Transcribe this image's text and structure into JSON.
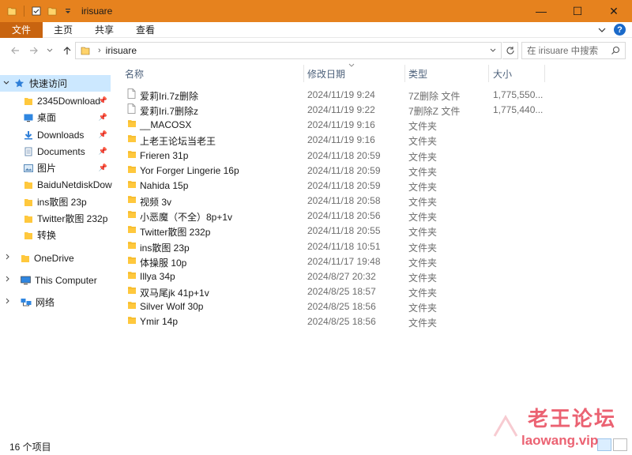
{
  "window": {
    "title": "irisuare",
    "controls": {
      "minimize": "—",
      "maximize": "☐",
      "close": "✕"
    }
  },
  "ribbon": {
    "tabs": [
      "文件",
      "主页",
      "共享",
      "查看"
    ],
    "help": "?"
  },
  "address": {
    "crumb": "irisuare",
    "search_placeholder": "在 irisuare 中搜索"
  },
  "sidebar": {
    "quick_access": "快速访问",
    "items": [
      {
        "label": "2345Download",
        "icon": "folder-icon",
        "pinned": true
      },
      {
        "label": "桌面",
        "icon": "desktop-icon",
        "pinned": true
      },
      {
        "label": "Downloads",
        "icon": "download-icon",
        "pinned": true
      },
      {
        "label": "Documents",
        "icon": "documents-icon",
        "pinned": true
      },
      {
        "label": "图片",
        "icon": "pictures-icon",
        "pinned": true
      },
      {
        "label": "BaiduNetdiskDow",
        "icon": "folder-icon",
        "pinned": false
      },
      {
        "label": "ins散图 23p",
        "icon": "folder-icon",
        "pinned": false
      },
      {
        "label": "Twitter散图 232p",
        "icon": "folder-icon",
        "pinned": false
      },
      {
        "label": "转换",
        "icon": "folder-icon",
        "pinned": false
      }
    ],
    "onedrive": "OneDrive",
    "this_computer": "This Computer",
    "network": "网络"
  },
  "columns": {
    "name": "名称",
    "date": "修改日期",
    "type": "类型",
    "size": "大小"
  },
  "files": [
    {
      "name": "爱莉Iri.7z删除",
      "date": "2024/11/19 9:24",
      "type": "7Z删除 文件",
      "size": "1,775,550...",
      "kind": "file"
    },
    {
      "name": "爱莉Iri.7删除z",
      "date": "2024/11/19 9:22",
      "type": "7删除Z 文件",
      "size": "1,775,440...",
      "kind": "file"
    },
    {
      "name": "__MACOSX",
      "date": "2024/11/19 9:16",
      "type": "文件夹",
      "size": "",
      "kind": "folder"
    },
    {
      "name": "上老王论坛当老王",
      "date": "2024/11/19 9:16",
      "type": "文件夹",
      "size": "",
      "kind": "folder"
    },
    {
      "name": "Frieren 31p",
      "date": "2024/11/18 20:59",
      "type": "文件夹",
      "size": "",
      "kind": "folder"
    },
    {
      "name": "Yor Forger Lingerie 16p",
      "date": "2024/11/18 20:59",
      "type": "文件夹",
      "size": "",
      "kind": "folder"
    },
    {
      "name": "Nahida 15p",
      "date": "2024/11/18 20:59",
      "type": "文件夹",
      "size": "",
      "kind": "folder"
    },
    {
      "name": "视频 3v",
      "date": "2024/11/18 20:58",
      "type": "文件夹",
      "size": "",
      "kind": "folder"
    },
    {
      "name": "小恶魔（不全）8p+1v",
      "date": "2024/11/18 20:56",
      "type": "文件夹",
      "size": "",
      "kind": "folder"
    },
    {
      "name": "Twitter散图 232p",
      "date": "2024/11/18 20:55",
      "type": "文件夹",
      "size": "",
      "kind": "folder"
    },
    {
      "name": "ins散图 23p",
      "date": "2024/11/18 10:51",
      "type": "文件夹",
      "size": "",
      "kind": "folder"
    },
    {
      "name": "体操服 10p",
      "date": "2024/11/17 19:48",
      "type": "文件夹",
      "size": "",
      "kind": "folder"
    },
    {
      "name": "Illya 34p",
      "date": "2024/8/27 20:32",
      "type": "文件夹",
      "size": "",
      "kind": "folder"
    },
    {
      "name": "双马尾jk 41p+1v",
      "date": "2024/8/25 18:57",
      "type": "文件夹",
      "size": "",
      "kind": "folder"
    },
    {
      "name": "Silver Wolf 30p",
      "date": "2024/8/25 18:56",
      "type": "文件夹",
      "size": "",
      "kind": "folder"
    },
    {
      "name": "Ymir 14p",
      "date": "2024/8/25 18:56",
      "type": "文件夹",
      "size": "",
      "kind": "folder"
    }
  ],
  "status": {
    "count": "16 个项目"
  },
  "watermark": {
    "line1": "老王论坛",
    "line2": "laowang.vip"
  },
  "colors": {
    "titlebar": "#e6821e",
    "file_tab": "#c86410",
    "selected": "#cce8ff",
    "folder": "#ffc83d",
    "watermark": "#e8475a"
  }
}
